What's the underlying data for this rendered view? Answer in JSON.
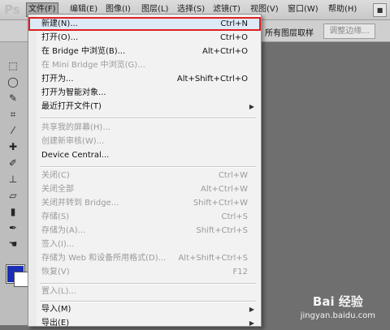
{
  "app": {
    "logo": "Ps",
    "window_button": "■"
  },
  "menubar": {
    "items": [
      {
        "label": "文件(F)"
      },
      {
        "label": "编辑(E)"
      },
      {
        "label": "图像(I)"
      },
      {
        "label": "图层(L)"
      },
      {
        "label": "选择(S)"
      },
      {
        "label": "滤镜(T)"
      },
      {
        "label": "视图(V)"
      },
      {
        "label": "窗口(W)"
      },
      {
        "label": "帮助(H)"
      }
    ]
  },
  "options_bar": {
    "sample_all_layers": "所有图层取样",
    "refine_edge_button": "调整边缘..."
  },
  "file_menu": {
    "items": [
      {
        "label": "新建(N)...",
        "shortcut": "Ctrl+N",
        "enabled": true,
        "highlighted": true
      },
      {
        "label": "打开(O)...",
        "shortcut": "Ctrl+O",
        "enabled": true
      },
      {
        "label": "在 Bridge 中浏览(B)...",
        "shortcut": "Alt+Ctrl+O",
        "enabled": true
      },
      {
        "label": "在 Mini Bridge 中浏览(G)...",
        "shortcut": "",
        "enabled": false
      },
      {
        "label": "打开为...",
        "shortcut": "Alt+Shift+Ctrl+O",
        "enabled": true
      },
      {
        "label": "打开为智能对象...",
        "shortcut": "",
        "enabled": true
      },
      {
        "label": "最近打开文件(T)",
        "shortcut": "",
        "enabled": true,
        "submenu": true
      },
      {
        "label": "共享我的屏幕(H)...",
        "shortcut": "",
        "enabled": false
      },
      {
        "label": "创建新审核(W)...",
        "shortcut": "",
        "enabled": false
      },
      {
        "label": "Device Central...",
        "shortcut": "",
        "enabled": true
      },
      {
        "label": "关闭(C)",
        "shortcut": "Ctrl+W",
        "enabled": false
      },
      {
        "label": "关闭全部",
        "shortcut": "Alt+Ctrl+W",
        "enabled": false
      },
      {
        "label": "关闭并转到 Bridge...",
        "shortcut": "Shift+Ctrl+W",
        "enabled": false
      },
      {
        "label": "存储(S)",
        "shortcut": "Ctrl+S",
        "enabled": false
      },
      {
        "label": "存储为(A)...",
        "shortcut": "Shift+Ctrl+S",
        "enabled": false
      },
      {
        "label": "签入(I)...",
        "shortcut": "",
        "enabled": false
      },
      {
        "label": "存储为 Web 和设备所用格式(D)...",
        "shortcut": "Alt+Shift+Ctrl+S",
        "enabled": false
      },
      {
        "label": "恢复(V)",
        "shortcut": "F12",
        "enabled": false
      },
      {
        "label": "置入(L)...",
        "shortcut": "",
        "enabled": false
      },
      {
        "label": "导入(M)",
        "shortcut": "",
        "enabled": true,
        "submenu": true
      },
      {
        "label": "导出(E)",
        "shortcut": "",
        "enabled": true,
        "submenu": true
      }
    ]
  },
  "colors": {
    "foreground": "#1a2fb5",
    "background": "#ffffff",
    "highlight_outline": "#e02020"
  },
  "watermark": {
    "text": "Bai 经验",
    "url": "jingyan.baidu.com"
  }
}
